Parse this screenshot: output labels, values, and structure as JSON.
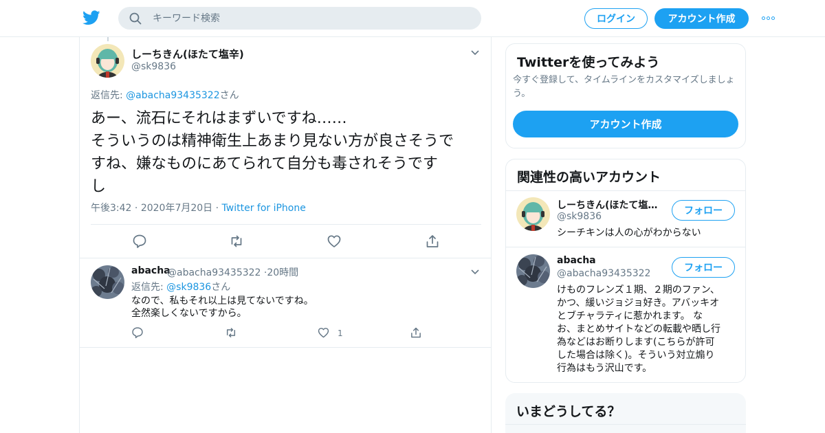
{
  "search": {
    "placeholder": "キーワード検索"
  },
  "nav": {
    "login_label": "ログイン",
    "signup_label": "アカウント作成"
  },
  "main_tweet": {
    "name": "しーちきん(ほたて塩辛)",
    "handle": "@sk9836",
    "reply_prefix": "返信先: ",
    "reply_target": "@abacha93435322",
    "reply_suffix": "さん",
    "text_lines": [
      "あー、流石にそれはまずいですね……",
      "そういうのは精神衛生上あまり見ない方が良さそうで",
      "すね、嫌なものにあてられて自分も毒されそうです",
      "し"
    ],
    "time": "午後3:42",
    "date": "2020年7月20日",
    "sep": "·",
    "source": "Twitter for iPhone"
  },
  "reply_tweet": {
    "name": "abacha",
    "handle": "@abacha93435322",
    "sep": "·",
    "time": "20時間",
    "reply_prefix": "返信先: ",
    "reply_target": "@sk9836",
    "reply_suffix": "さん",
    "text_lines": [
      "なので、私もそれ以上は見てないですね。",
      "全然楽しくないですから。"
    ],
    "like_count": "1"
  },
  "signup_card": {
    "title": "Twitterを使ってみよう",
    "subtitle": "今すぐ登録して、タイムラインをカスタマイズしましょう。",
    "button_label": "アカウント作成"
  },
  "related": {
    "title": "関連性の高いアカウント",
    "accounts": [
      {
        "name": "しーちきん(ほたて塩…",
        "handle": "@sk9836",
        "follow_label": "フォロー",
        "bio_lines": [
          "シーチキンは人の心がわからない"
        ]
      },
      {
        "name": "abacha",
        "handle": "@abacha93435322",
        "follow_label": "フォロー",
        "bio_lines": [
          "けものフレンズ１期、２期のファン、",
          "かつ、緩いジョジョ好き。アバッキオ",
          "とブチャラティに惹かれます。 な",
          "お、まとめサイトなどの転載や晒し行",
          "為などはお断りします(こちらが許可",
          "した場合は除く)。そういう対立煽り",
          "行為はもう沢山です。"
        ]
      }
    ]
  },
  "trends": {
    "title": "いまどうしてる？"
  },
  "colors": {
    "accent": "#1da1f2",
    "link": "#1b95e0",
    "muted": "#657786",
    "border": "#e6ecf0"
  },
  "icons": [
    "twitter-bird-icon",
    "search-icon",
    "more-icon",
    "chevron-down-icon",
    "reply-icon",
    "retweet-icon",
    "like-icon",
    "share-icon"
  ]
}
